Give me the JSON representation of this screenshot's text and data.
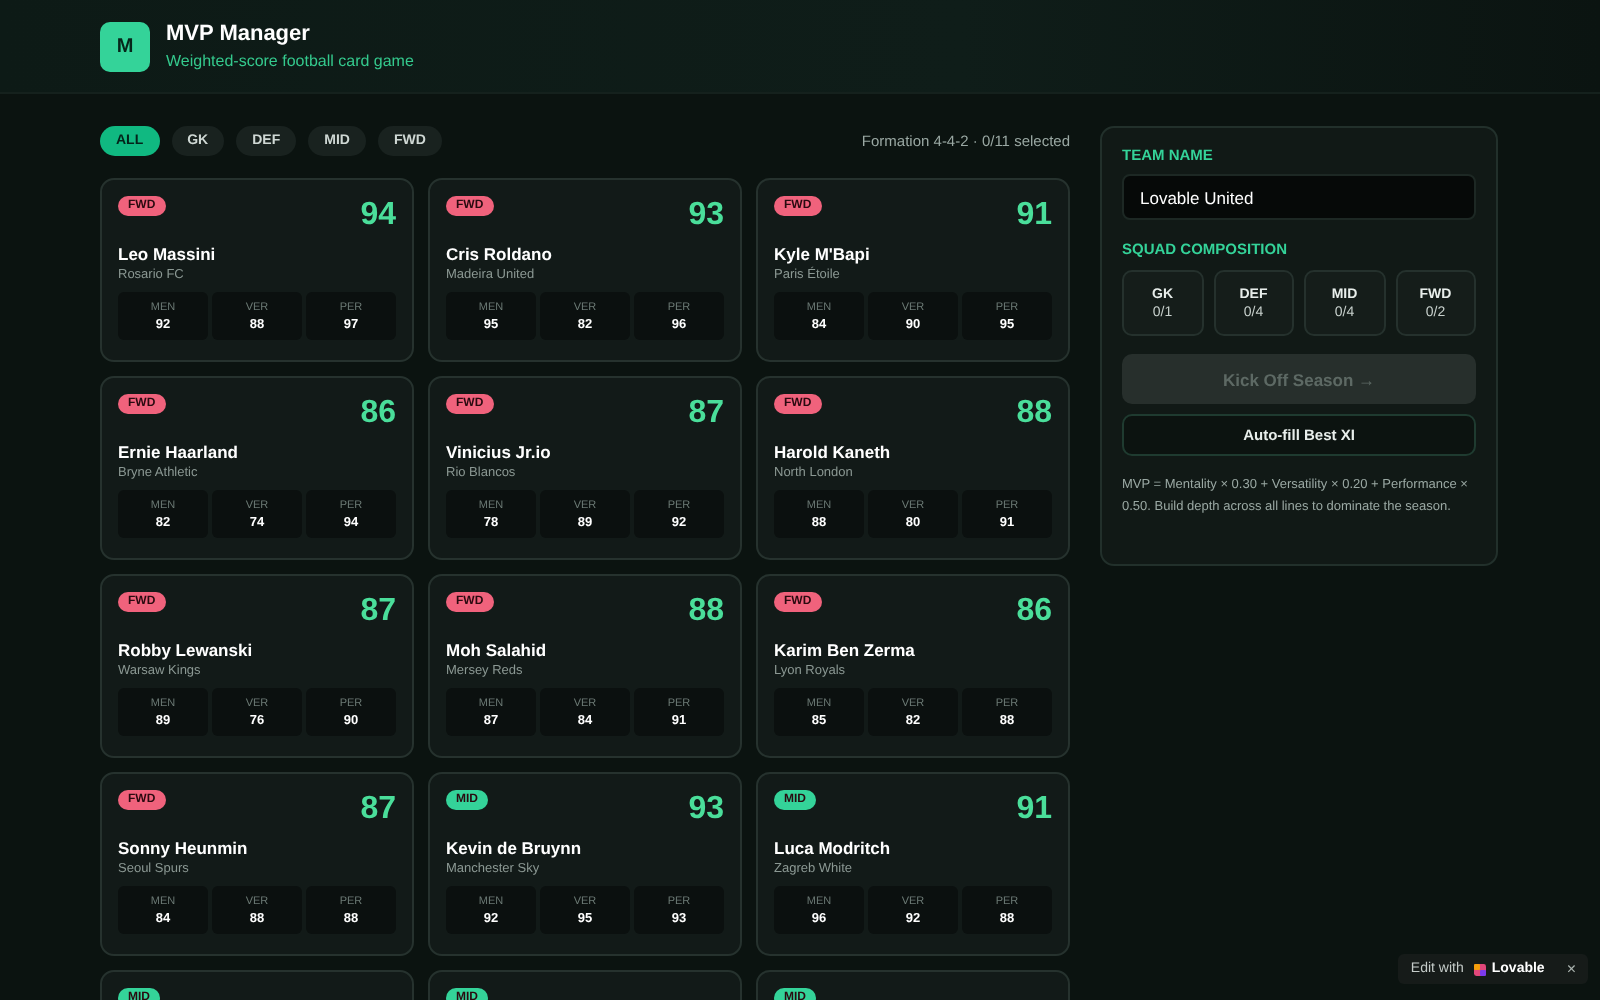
{
  "header": {
    "logo_letter": "M",
    "title": "MVP Manager",
    "subtitle": "Weighted-score football card game"
  },
  "filters": [
    {
      "label": "ALL",
      "selected": true
    },
    {
      "label": "GK",
      "selected": false
    },
    {
      "label": "DEF",
      "selected": false
    },
    {
      "label": "MID",
      "selected": false
    },
    {
      "label": "FWD",
      "selected": false
    }
  ],
  "formation_status": "Formation 4-4-2 · 0/11 selected",
  "players": [
    {
      "position": "FWD",
      "color": "#f0627c",
      "score": "94",
      "name": "Leo Massini",
      "club": "Rosario FC",
      "stats": [
        {
          "label": "MEN",
          "value": "92"
        },
        {
          "label": "VER",
          "value": "88"
        },
        {
          "label": "PER",
          "value": "97"
        }
      ]
    },
    {
      "position": "FWD",
      "color": "#f0627c",
      "score": "93",
      "name": "Cris Roldano",
      "club": "Madeira United",
      "stats": [
        {
          "label": "MEN",
          "value": "95"
        },
        {
          "label": "VER",
          "value": "82"
        },
        {
          "label": "PER",
          "value": "96"
        }
      ]
    },
    {
      "position": "FWD",
      "color": "#f0627c",
      "score": "91",
      "name": "Kyle M'Bapi",
      "club": "Paris Étoile",
      "stats": [
        {
          "label": "MEN",
          "value": "84"
        },
        {
          "label": "VER",
          "value": "90"
        },
        {
          "label": "PER",
          "value": "95"
        }
      ]
    },
    {
      "position": "FWD",
      "color": "#f0627c",
      "score": "86",
      "name": "Ernie Haarland",
      "club": "Bryne Athletic",
      "stats": [
        {
          "label": "MEN",
          "value": "82"
        },
        {
          "label": "VER",
          "value": "74"
        },
        {
          "label": "PER",
          "value": "94"
        }
      ]
    },
    {
      "position": "FWD",
      "color": "#f0627c",
      "score": "87",
      "name": "Vinicius Jr.io",
      "club": "Rio Blancos",
      "stats": [
        {
          "label": "MEN",
          "value": "78"
        },
        {
          "label": "VER",
          "value": "89"
        },
        {
          "label": "PER",
          "value": "92"
        }
      ]
    },
    {
      "position": "FWD",
      "color": "#f0627c",
      "score": "88",
      "name": "Harold Kaneth",
      "club": "North London",
      "stats": [
        {
          "label": "MEN",
          "value": "88"
        },
        {
          "label": "VER",
          "value": "80"
        },
        {
          "label": "PER",
          "value": "91"
        }
      ]
    },
    {
      "position": "FWD",
      "color": "#f0627c",
      "score": "87",
      "name": "Robby Lewanski",
      "club": "Warsaw Kings",
      "stats": [
        {
          "label": "MEN",
          "value": "89"
        },
        {
          "label": "VER",
          "value": "76"
        },
        {
          "label": "PER",
          "value": "90"
        }
      ]
    },
    {
      "position": "FWD",
      "color": "#f0627c",
      "score": "88",
      "name": "Moh Salahid",
      "club": "Mersey Reds",
      "stats": [
        {
          "label": "MEN",
          "value": "87"
        },
        {
          "label": "VER",
          "value": "84"
        },
        {
          "label": "PER",
          "value": "91"
        }
      ]
    },
    {
      "position": "FWD",
      "color": "#f0627c",
      "score": "86",
      "name": "Karim Ben Zerma",
      "club": "Lyon Royals",
      "stats": [
        {
          "label": "MEN",
          "value": "85"
        },
        {
          "label": "VER",
          "value": "82"
        },
        {
          "label": "PER",
          "value": "88"
        }
      ]
    },
    {
      "position": "FWD",
      "color": "#f0627c",
      "score": "87",
      "name": "Sonny Heunmin",
      "club": "Seoul Spurs",
      "stats": [
        {
          "label": "MEN",
          "value": "84"
        },
        {
          "label": "VER",
          "value": "88"
        },
        {
          "label": "PER",
          "value": "88"
        }
      ]
    },
    {
      "position": "MID",
      "color": "#34d399",
      "score": "93",
      "name": "Kevin de Bruynn",
      "club": "Manchester Sky",
      "stats": [
        {
          "label": "MEN",
          "value": "92"
        },
        {
          "label": "VER",
          "value": "95"
        },
        {
          "label": "PER",
          "value": "93"
        }
      ]
    },
    {
      "position": "MID",
      "color": "#34d399",
      "score": "91",
      "name": "Luca Modritch",
      "club": "Zagreb White",
      "stats": [
        {
          "label": "MEN",
          "value": "96"
        },
        {
          "label": "VER",
          "value": "92"
        },
        {
          "label": "PER",
          "value": "88"
        }
      ]
    },
    {
      "position": "MID",
      "color": "#34d399"
    },
    {
      "position": "MID",
      "color": "#34d399"
    },
    {
      "position": "MID",
      "color": "#34d399"
    }
  ],
  "panel": {
    "team_name": {
      "label": "TEAM NAME",
      "value": "Lovable United"
    },
    "squad": {
      "label": "SQUAD COMPOSITION",
      "slots": [
        {
          "position": "GK",
          "count": "0/1"
        },
        {
          "position": "DEF",
          "count": "0/4"
        },
        {
          "position": "MID",
          "count": "0/4"
        },
        {
          "position": "FWD",
          "count": "0/2"
        }
      ]
    },
    "kickoff_button": {
      "label": "Kick Off Season →",
      "disabled": true
    },
    "autofill_button": {
      "label": "Auto-fill Best XI"
    },
    "note": "MVP = Mentality × 0.30 + Versatility × 0.20 + Performance × 0.50. Build depth across all lines to dominate the season."
  },
  "edit_badge": {
    "prefix": "Edit with",
    "brand": "Lovable",
    "close": "×"
  }
}
